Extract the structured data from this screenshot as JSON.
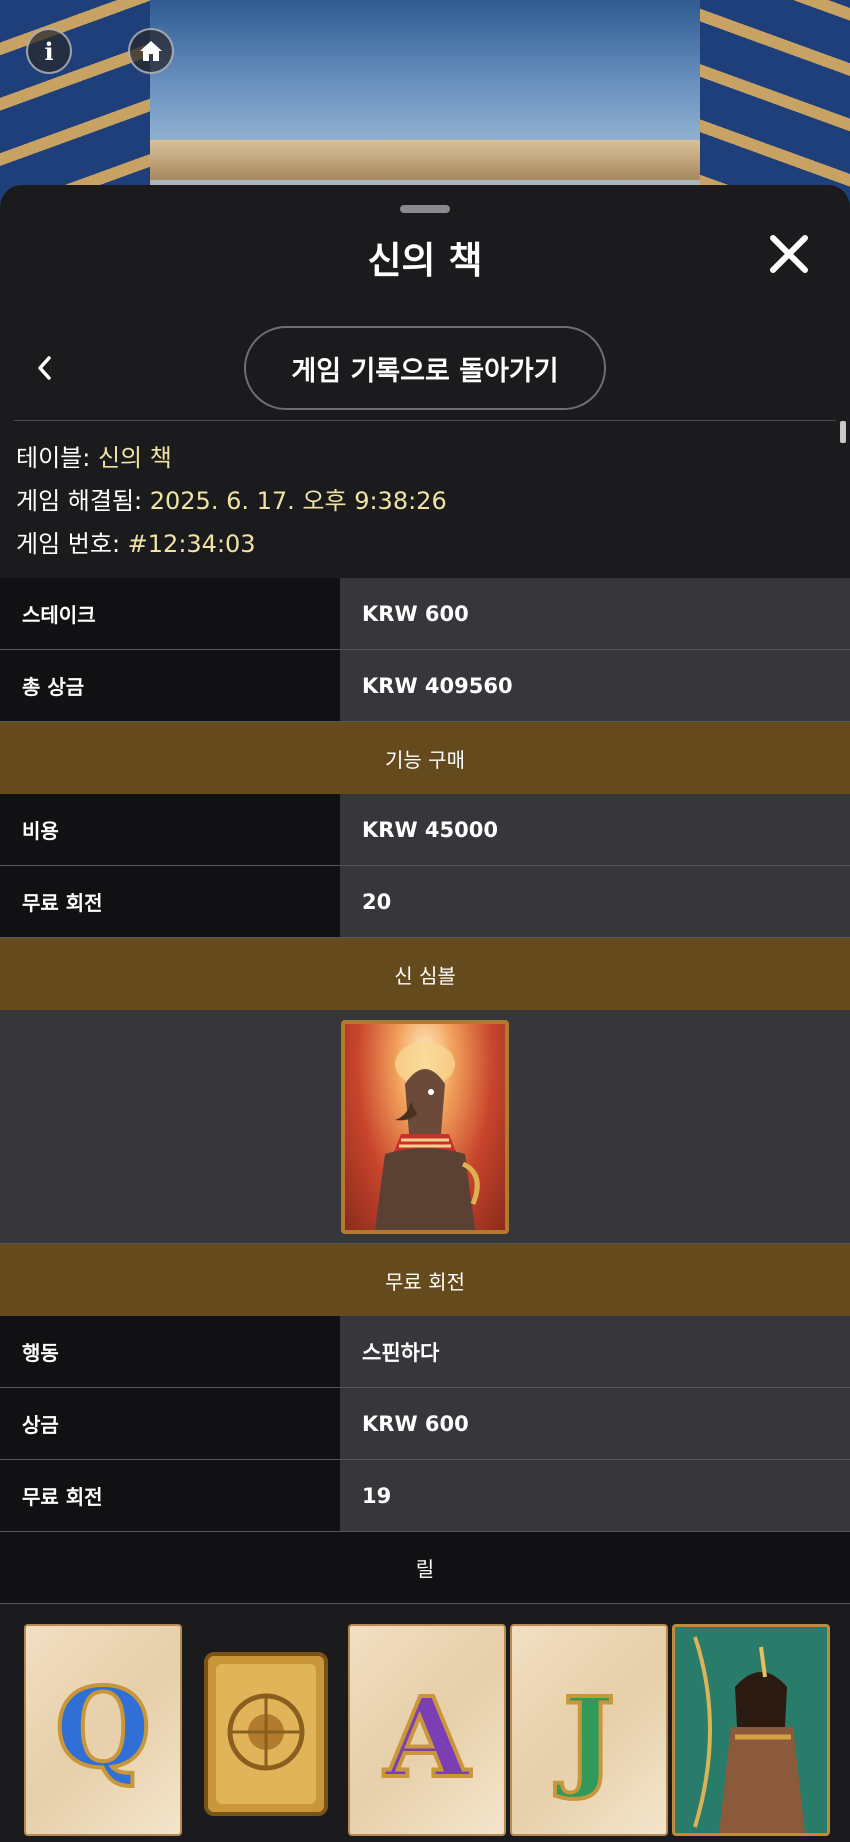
{
  "sheet": {
    "title": "신의 책",
    "back_to_history": "게임 기록으로 돌아가기"
  },
  "meta": {
    "table_label": "테이블: ",
    "table_value": "신의 책",
    "resolved_label": "게임 해결됨: ",
    "resolved_value": "2025. 6. 17. 오후 9:38:26",
    "number_label": "게임 번호: ",
    "number_value": "#12:34:03"
  },
  "summary": {
    "rows": [
      {
        "label": "스테이크",
        "value": "KRW 600"
      },
      {
        "label": "총 상금",
        "value": "KRW 409560"
      }
    ]
  },
  "feature_buy": {
    "header": "기능 구매",
    "rows": [
      {
        "label": "비용",
        "value": "KRW 45000"
      },
      {
        "label": "무료 회전",
        "value": "20"
      }
    ]
  },
  "god_symbol": {
    "header": "신 심볼",
    "symbol_icon": "horus-god-symbol-icon"
  },
  "free_spin": {
    "header": "무료 회전",
    "rows": [
      {
        "label": "행동",
        "value": "스핀하다"
      },
      {
        "label": "상금",
        "value": "KRW 600"
      },
      {
        "label": "무료 회전",
        "value": "19"
      }
    ]
  },
  "reels": {
    "header": "릴",
    "symbols": [
      {
        "icon": "letter-symbol-icon",
        "glyph": "Q",
        "color": "#2f6fd6"
      },
      {
        "icon": "book-symbol-icon"
      },
      {
        "icon": "letter-symbol-icon",
        "glyph": "A",
        "color": "#7b3fb5"
      },
      {
        "icon": "letter-symbol-icon",
        "glyph": "J",
        "color": "#2f9a5a"
      },
      {
        "icon": "archer-symbol-icon"
      }
    ]
  },
  "colors": {
    "section_header": "#654a1d",
    "label_cell": "#111114",
    "value_cell": "#36363b",
    "meta_value": "#f0e3a3"
  }
}
